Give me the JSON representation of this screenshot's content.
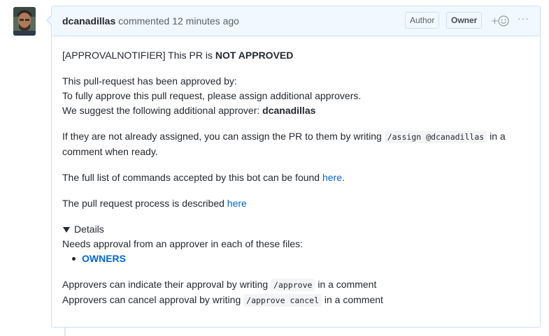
{
  "header": {
    "author": "dcanadillas",
    "action": "commented",
    "time": "12 minutes ago",
    "badges": [
      "Author",
      "Owner"
    ],
    "reaction_icon": "smiley-plus-icon",
    "more_icon": "kebab-horizontal-icon",
    "more_glyph": "···"
  },
  "body": {
    "line1_prefix": "[APPROVALNOTIFIER] This PR is ",
    "line1_status": "NOT APPROVED",
    "approved_by": "This pull-request has been approved by:",
    "fully_approve": "To fully approve this pull request, please assign additional approvers.",
    "suggest_prefix": "We suggest the following additional approver: ",
    "suggest_user": "dcanadillas",
    "assign_prefix": "If they are not already assigned, you can assign the PR to them by writing ",
    "assign_code": "/assign @dcanadillas",
    "assign_suffix": " in a comment when ready.",
    "commands_prefix": "The full list of commands accepted by this bot can be found ",
    "commands_link": "here",
    "commands_suffix": ".",
    "process_prefix": "The pull request process is described ",
    "process_link": "here",
    "details_label": "Details",
    "needs_approval": "Needs approval from an approver in each of these files:",
    "files": [
      "OWNERS"
    ],
    "approve_prefix": "Approvers can indicate their approval by writing ",
    "approve_code": "/approve",
    "approve_suffix": " in a comment",
    "cancel_prefix": "Approvers can cancel approval by writing ",
    "cancel_code": "/approve cancel",
    "cancel_suffix": " in a comment"
  },
  "colors": {
    "link": "#0366d6",
    "header_bg": "#f1f8ff",
    "border": "#c8e1ff"
  }
}
